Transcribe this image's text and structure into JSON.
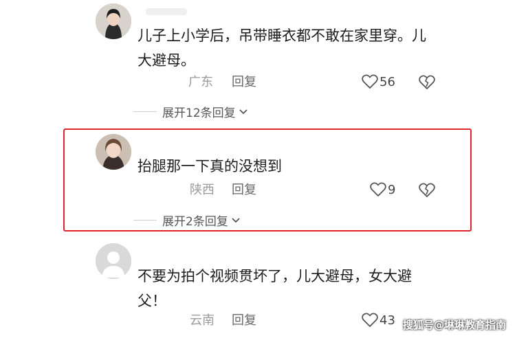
{
  "comments": [
    {
      "text_line1": "儿子上小学后，吊带睡衣都不敢在家里穿。儿",
      "text_line2": "大避母。",
      "region": "广东",
      "reply_label": "回复",
      "likes": "56",
      "expand_label": "展开12条回复"
    },
    {
      "text_line1": "抬腿那一下真的没想到",
      "region": "陕西",
      "reply_label": "回复",
      "likes": "9",
      "expand_label": "展开2条回复"
    },
    {
      "text_line1": "不要为拍个视频贯坏了，儿大避母，女大避",
      "text_line2": "父！",
      "region": "云南",
      "reply_label": "回复",
      "likes": "43"
    }
  ],
  "highlight_color": "#e0242c",
  "icons": [
    "heart-outline-icon",
    "broken-heart-icon",
    "chevron-down-icon",
    "default-avatar-icon"
  ],
  "watermark": "搜狐号@琳琳教育指南"
}
